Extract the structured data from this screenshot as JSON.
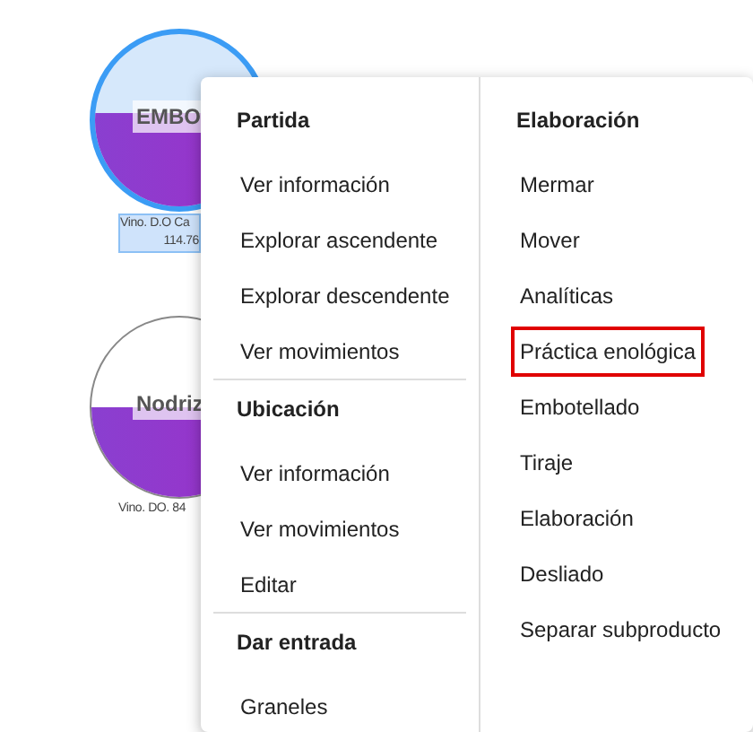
{
  "tanks": [
    {
      "name": "EMBO",
      "caption": "Vino. D.O Ca",
      "volume": "114.76",
      "selected": true,
      "level": 0.54
    },
    {
      "name": "Nodriz",
      "caption": "Vino. DO. 84",
      "selected": false,
      "level": 0.5
    }
  ],
  "context_menu": {
    "columns": [
      {
        "sections": [
          {
            "title": "Partida",
            "items": [
              {
                "label": "Ver información"
              },
              {
                "label": "Explorar ascendente"
              },
              {
                "label": "Explorar descendente"
              },
              {
                "label": "Ver movimientos"
              }
            ]
          },
          {
            "title": "Ubicación",
            "items": [
              {
                "label": "Ver información"
              },
              {
                "label": "Ver movimientos"
              },
              {
                "label": "Editar"
              }
            ]
          },
          {
            "title": "Dar entrada",
            "items": [
              {
                "label": "Graneles"
              }
            ]
          }
        ]
      },
      {
        "sections": [
          {
            "title": "Elaboración",
            "items": [
              {
                "label": "Mermar",
                "selected": false
              },
              {
                "label": "Mover",
                "selected": false
              },
              {
                "label": "Analíticas",
                "selected": false
              },
              {
                "label": "Práctica enológica",
                "selected": true
              },
              {
                "label": "Embotellado",
                "selected": false
              },
              {
                "label": "Tiraje",
                "selected": false
              },
              {
                "label": "Elaboración",
                "selected": false
              },
              {
                "label": "Desliado",
                "selected": false
              },
              {
                "label": "Separar subproducto",
                "selected": false
              }
            ]
          }
        ]
      }
    ]
  }
}
